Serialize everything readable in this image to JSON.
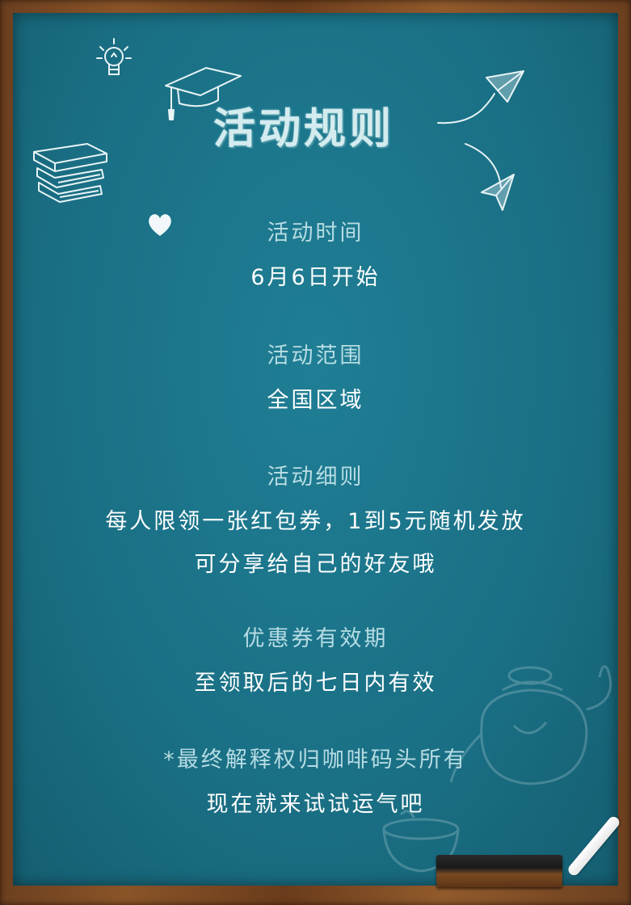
{
  "title": "活动规则",
  "sections": [
    {
      "label": "活动时间",
      "lines": [
        "6月6日开始"
      ]
    },
    {
      "label": "活动范围",
      "lines": [
        "全国区域"
      ]
    },
    {
      "label": "活动细则",
      "lines": [
        "每人限领一张红包券，1到5元随机发放",
        "可分享给自己的好友哦"
      ]
    },
    {
      "label": "优惠券有效期",
      "lines": [
        "至领取后的七日内有效"
      ]
    },
    {
      "label": "*最终解释权归咖啡码头所有",
      "lines": [
        "现在就来试试运气吧"
      ]
    }
  ],
  "colors": {
    "board": "#1a6f84",
    "frame": "#7a4a22",
    "label": "#b6dce3",
    "value": "#ffffff"
  }
}
